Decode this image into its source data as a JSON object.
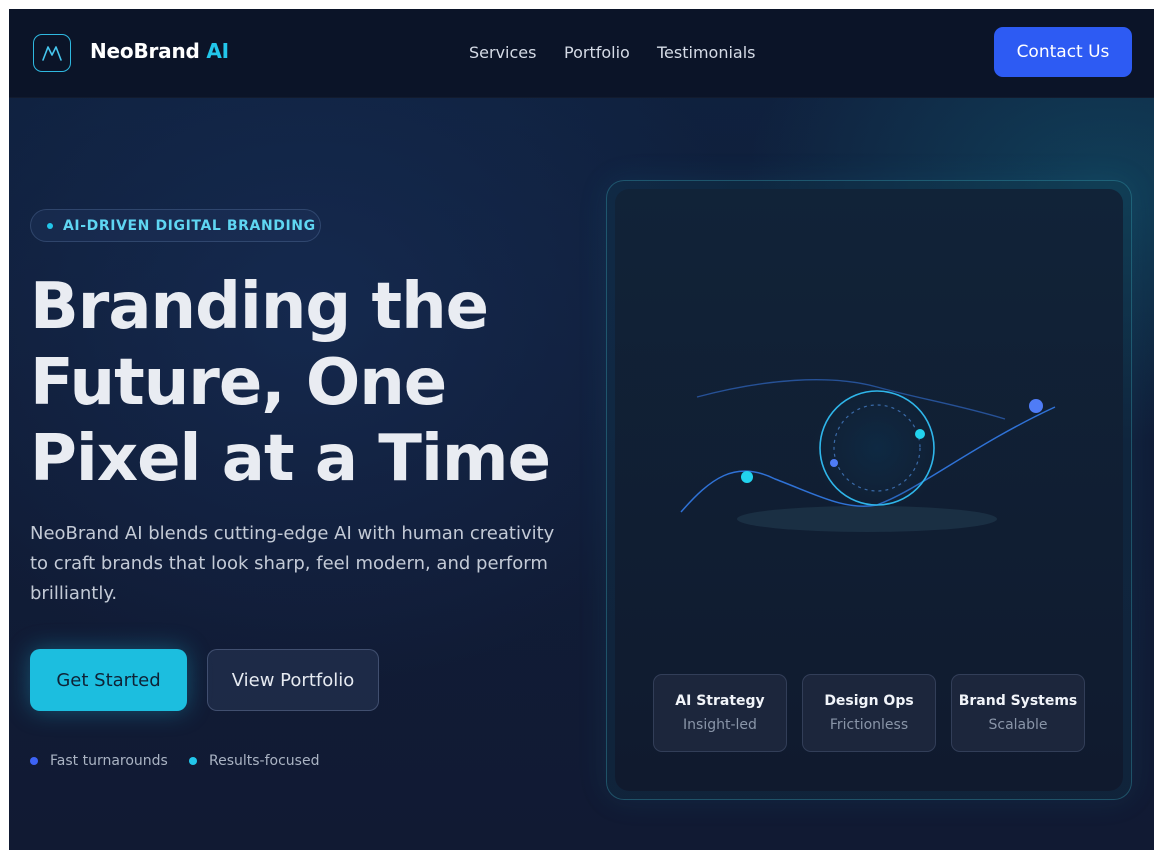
{
  "header": {
    "brand_name": "NeoBrand",
    "brand_accent": "AI",
    "nav": [
      "Services",
      "Portfolio",
      "Testimonials"
    ],
    "contact_label": "Contact Us"
  },
  "hero": {
    "badge": "AI-DRIVEN DIGITAL BRANDING",
    "headline": [
      "Branding the",
      "Future, One",
      "Pixel at a Time"
    ],
    "description": "NeoBrand AI blends cutting-edge AI with human creativity to craft brands that look sharp, feel modern, and perform brilliantly.",
    "primary_cta": "Get Started",
    "secondary_cta": "View Portfolio",
    "features": [
      {
        "label": "Fast turnarounds",
        "color": "#3d63f4"
      },
      {
        "label": "Results-focused",
        "color": "#22c6ea"
      }
    ]
  },
  "visual": {
    "chips": [
      {
        "title": "AI Strategy",
        "subtitle": "Insight-led"
      },
      {
        "title": "Design Ops",
        "subtitle": "Frictionless"
      },
      {
        "title": "Brand Systems",
        "subtitle": "Scalable"
      }
    ]
  },
  "colors": {
    "accent_cyan": "#22c6ea",
    "accent_blue": "#2d5bf3",
    "background": "#101d38"
  }
}
